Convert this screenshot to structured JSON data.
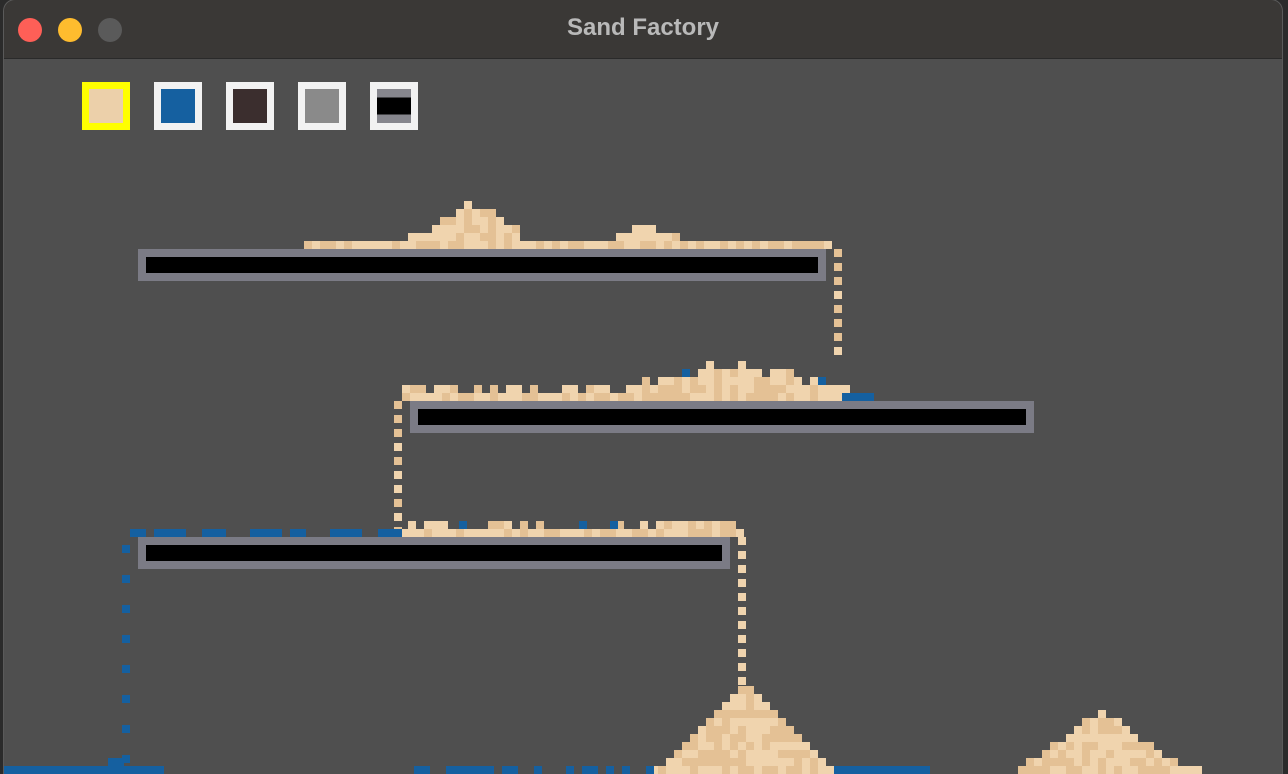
{
  "window": {
    "title": "Sand Factory"
  },
  "palette": {
    "selected": "sand",
    "materials": [
      {
        "name": "sand",
        "color": "#ecccA2",
        "icon": "sand-swatch"
      },
      {
        "name": "water",
        "color": "#1560a0",
        "icon": "water-swatch"
      },
      {
        "name": "dirt",
        "color": "#3b2e2e",
        "icon": "dirt-swatch"
      },
      {
        "name": "stone",
        "color": "#8a8a8a",
        "icon": "stone-swatch"
      },
      {
        "name": "wall",
        "color": "#000000",
        "icon": "wall-swatch"
      }
    ]
  },
  "colors": {
    "background": "#4f4f4f",
    "titlebar": "#3a3836",
    "selection_outline": "#ffff00",
    "swatch_outline": "#f2f2f2",
    "platform_edge": "#7b7b85",
    "platform_core": "#000000",
    "sand_light": "#f0d4ae",
    "sand_dark": "#e4c195",
    "water": "#1560a0"
  }
}
